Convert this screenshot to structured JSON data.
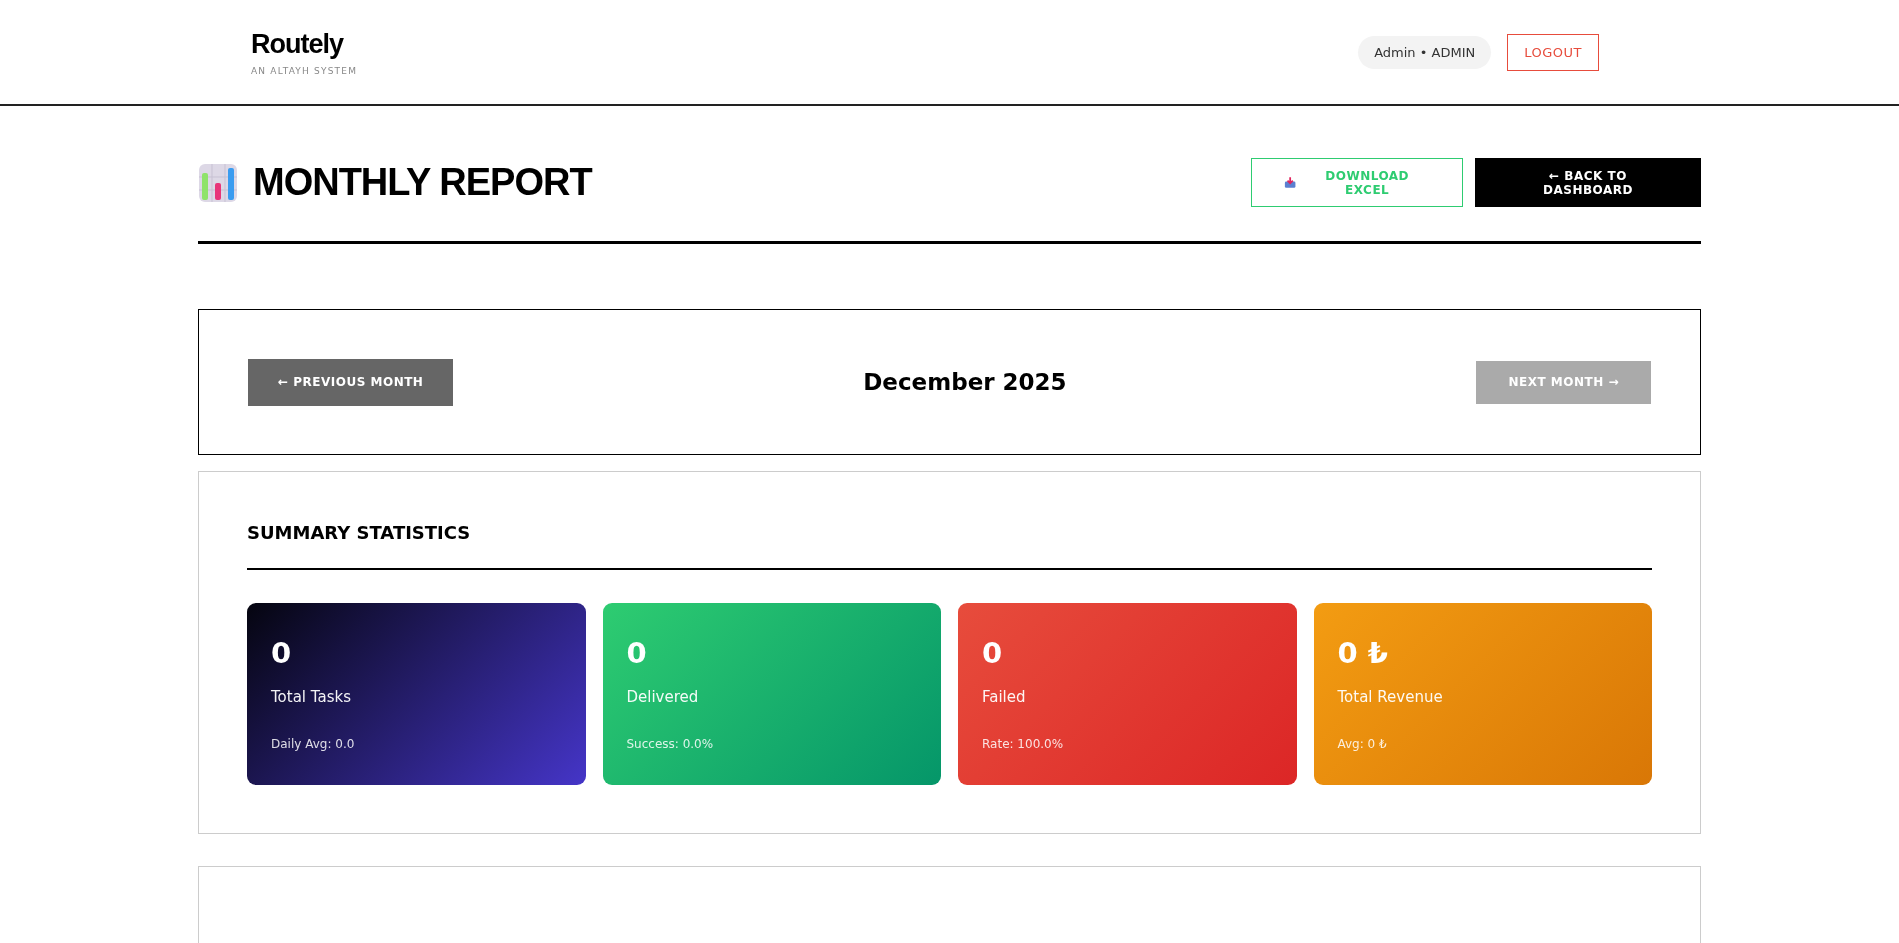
{
  "brand": {
    "name": "Routely",
    "tagline": "AN ALTAYH SYSTEM"
  },
  "user": {
    "label": "Admin • ADMIN"
  },
  "logout": {
    "label": "LOGOUT"
  },
  "page": {
    "title": "MONTHLY REPORT"
  },
  "actions": [
    {
      "kind": "download",
      "label": "DOWNLOAD EXCEL"
    },
    {
      "kind": "back",
      "label": "← BACK TO DASHBOARD"
    }
  ],
  "month_nav": {
    "previous": {
      "label": "← PREVIOUS MONTH",
      "disabled": false
    },
    "current": "December 2025",
    "next": {
      "label": "NEXT MONTH →",
      "disabled": true
    }
  },
  "summary": {
    "title": "SUMMARY STATISTICS",
    "cards": [
      {
        "kind": "tasks",
        "value": "0",
        "label": "Total Tasks",
        "sub": "Daily Avg: 0.0"
      },
      {
        "kind": "delivered",
        "value": "0",
        "label": "Delivered",
        "sub": "Success: 0.0%"
      },
      {
        "kind": "failed",
        "value": "0",
        "label": "Failed",
        "sub": "Rate: 100.0%"
      },
      {
        "kind": "revenue",
        "value": "0 ₺",
        "label": "Total Revenue",
        "sub": "Avg: 0 ₺"
      }
    ]
  }
}
